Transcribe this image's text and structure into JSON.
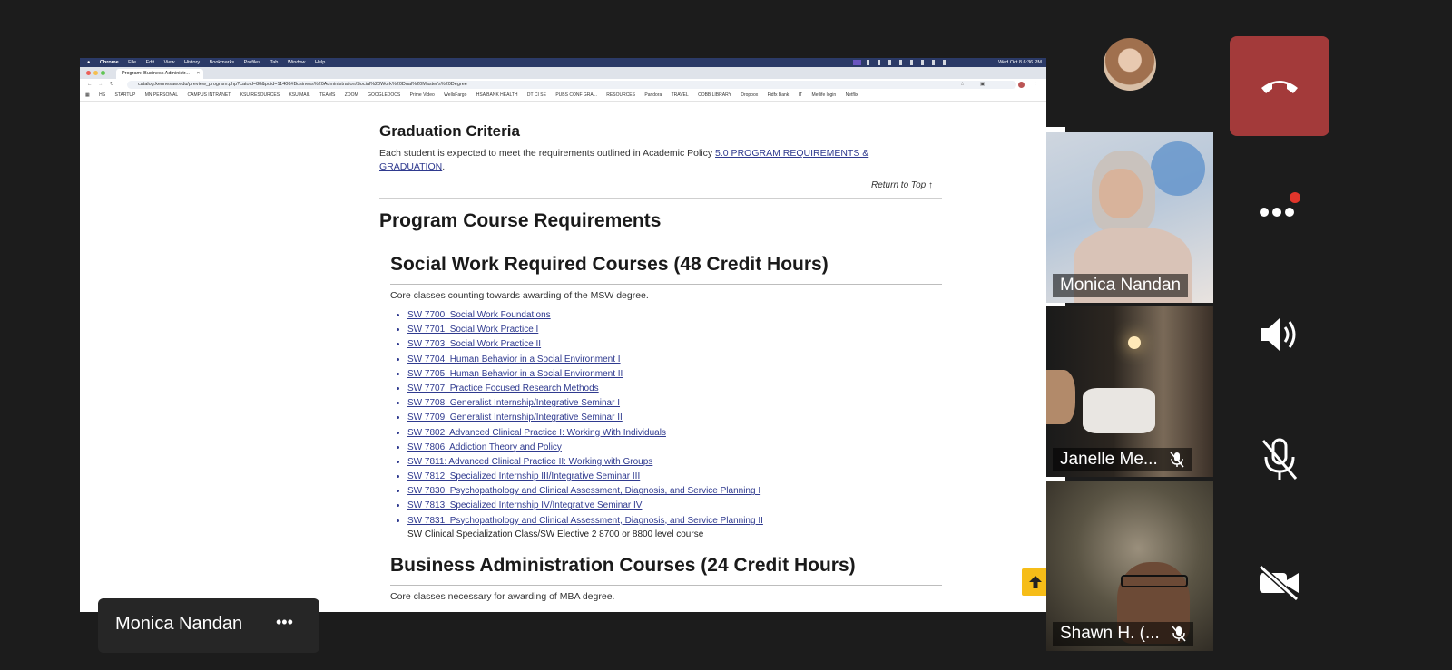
{
  "browser": {
    "menu_items": [
      "Chrome",
      "File",
      "Edit",
      "View",
      "History",
      "Bookmarks",
      "Profiles",
      "Tab",
      "Window",
      "Help"
    ],
    "clock": "Wed Oct 8  6:36 PM",
    "tab_title": "Program: Business Administr...",
    "url": "catalog.kennesaw.edu/preview_program.php?catoid=80&poid=11400#Business%20Administration/Social%20Work%20Dual%20Master's%20Degree",
    "bookmarks": [
      "HS",
      "STARTUP",
      "MN PERSONAL",
      "CAMPUS INTRANET",
      "KSU RESOURCES",
      "KSU MAIL",
      "TEAMS",
      "ZOOM",
      "GOOGLEDOCS",
      "Prime Video",
      "WellsFargo",
      "HSA BANK HEALTH",
      "DT CI SE",
      "PUBS CONF GRA...",
      "RESOURCES",
      "Pandora",
      "TRAVEL",
      "COBB LIBRARY",
      "Dropbox",
      "Fidfx Bank",
      "IT",
      "Metlife login",
      "Netflix"
    ]
  },
  "page": {
    "grad_heading": "Graduation Criteria",
    "grad_text": "Each student is expected to meet the requirements outlined in Academic Policy ",
    "grad_link": "5.0 PROGRAM REQUIREMENTS & GRADUATION",
    "grad_period": ".",
    "return_top": "Return to Top ↑",
    "prog_heading": "Program Course Requirements",
    "sw_heading": "Social Work Required Courses (48 Credit Hours)",
    "sw_desc": "Core classes counting towards awarding of the MSW degree.",
    "sw_courses": [
      "SW 7700: Social Work Foundations",
      "SW 7701: Social Work Practice I",
      "SW 7703: Social Work Practice II",
      "SW 7704: Human Behavior in a Social Environment I",
      "SW 7705: Human Behavior in a Social Environment II",
      "SW 7707: Practice Focused Research Methods",
      "SW 7708: Generalist Internship/Integrative Seminar I",
      "SW 7709: Generalist Internship/Integrative Seminar II",
      "SW 7802: Advanced Clinical Practice I: Working With Individuals",
      "SW 7806: Addiction Theory and Policy",
      "SW 7811: Advanced Clinical Practice II: Working with Groups",
      "SW 7812: Specialized Internship III/Integrative Seminar III",
      "SW 7830: Psychopathology and Clinical Assessment, Diagnosis, and Service Planning I",
      "SW 7813: Specialized Internship IV/Integrative Seminar IV",
      "SW 7831: Psychopathology and Clinical Assessment, Diagnosis, and Service Planning II"
    ],
    "sw_elective": "SW Clinical Specialization Class/SW Elective 2 8700 or 8800 level course",
    "ba_heading": "Business Administration Courses (24 Credit Hours)",
    "ba_desc": "Core classes necessary for awarding of MBA degree."
  },
  "meeting": {
    "presenter_label": "Monica Nandan",
    "more_label": "•••",
    "participants": [
      {
        "name": "Monica Nandan",
        "muted": false
      },
      {
        "name": "Janelle Me...",
        "muted": true
      },
      {
        "name": "Shawn H. (...",
        "muted": true
      }
    ],
    "colors": {
      "leave": "#a33a3a",
      "notification": "#e0352b",
      "scroll_top": "#f6bd18"
    }
  }
}
